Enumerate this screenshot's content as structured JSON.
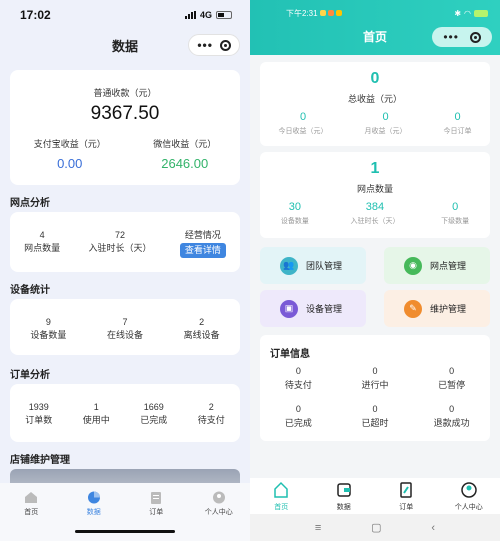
{
  "left": {
    "status": {
      "time": "17:02",
      "network": "4G"
    },
    "nav_title": "数据",
    "summary": {
      "normal_label": "普通收款（元）",
      "normal_value": "9367.50",
      "alipay_label": "支付宝收益（元）",
      "alipay_value": "0.00",
      "wechat_label": "微信收益（元）",
      "wechat_value": "2646.00"
    },
    "outlet": {
      "title": "网点分析",
      "items": [
        {
          "value": "4",
          "label": "网点数量"
        },
        {
          "value": "72",
          "label": "入驻时长（天）"
        },
        {
          "value": "经营情况",
          "label": "查看详情"
        }
      ]
    },
    "device": {
      "title": "设备统计",
      "items": [
        {
          "value": "9",
          "label": "设备数量"
        },
        {
          "value": "7",
          "label": "在线设备"
        },
        {
          "value": "2",
          "label": "离线设备"
        }
      ]
    },
    "order": {
      "title": "订单分析",
      "items": [
        {
          "value": "1939",
          "label": "订单数"
        },
        {
          "value": "1",
          "label": "使用中"
        },
        {
          "value": "1669",
          "label": "已完成"
        },
        {
          "value": "2",
          "label": "待支付"
        }
      ]
    },
    "store_title": "店铺维护管理",
    "tabs": [
      "首页",
      "数据",
      "订单",
      "个人中心"
    ]
  },
  "right": {
    "status": {
      "time": "下午2:31"
    },
    "nav_title": "首页",
    "income": {
      "total_value": "0",
      "total_label": "总收益（元）",
      "items": [
        {
          "value": "0",
          "label": "今日收益（元）"
        },
        {
          "value": "0",
          "label": "月收益（元）"
        },
        {
          "value": "0",
          "label": "今日订单"
        }
      ]
    },
    "outlet": {
      "total_value": "1",
      "total_label": "网点数量",
      "items": [
        {
          "value": "30",
          "label": "设备数量"
        },
        {
          "value": "384",
          "label": "入驻时长（天）"
        },
        {
          "value": "0",
          "label": "下级数量"
        }
      ]
    },
    "mgmt": [
      "团队管理",
      "网点管理",
      "设备管理",
      "维护管理"
    ],
    "orders": {
      "title": "订单信息",
      "items": [
        {
          "value": "0",
          "label": "待支付"
        },
        {
          "value": "0",
          "label": "进行中"
        },
        {
          "value": "0",
          "label": "已暂停"
        },
        {
          "value": "0",
          "label": "已完成"
        },
        {
          "value": "0",
          "label": "已超时"
        },
        {
          "value": "0",
          "label": "退款成功"
        }
      ]
    },
    "tabs": [
      "首页",
      "数据",
      "订单",
      "个人中心"
    ]
  },
  "colors": {
    "teal": "#1fbfb0",
    "blue": "#3a6fd8",
    "green": "#33b36a",
    "button_blue": "#3f86e0"
  }
}
